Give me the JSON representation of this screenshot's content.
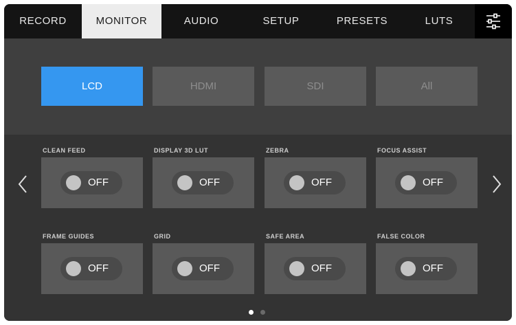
{
  "tabs": [
    {
      "label": "RECORD",
      "active": false
    },
    {
      "label": "MONITOR",
      "active": true
    },
    {
      "label": "AUDIO",
      "active": false
    },
    {
      "label": "SETUP",
      "active": false
    },
    {
      "label": "PRESETS",
      "active": false
    },
    {
      "label": "LUTS",
      "active": false
    }
  ],
  "settings_icon": "sliders-icon",
  "outputs": [
    {
      "label": "LCD",
      "active": true
    },
    {
      "label": "HDMI",
      "active": false
    },
    {
      "label": "SDI",
      "active": false
    },
    {
      "label": "All",
      "active": false
    }
  ],
  "toggles": [
    {
      "label": "CLEAN FEED",
      "state": "OFF"
    },
    {
      "label": "DISPLAY 3D LUT",
      "state": "OFF"
    },
    {
      "label": "ZEBRA",
      "state": "OFF"
    },
    {
      "label": "FOCUS ASSIST",
      "state": "OFF"
    },
    {
      "label": "FRAME GUIDES",
      "state": "OFF"
    },
    {
      "label": "GRID",
      "state": "OFF"
    },
    {
      "label": "SAFE AREA",
      "state": "OFF"
    },
    {
      "label": "FALSE COLOR",
      "state": "OFF"
    }
  ],
  "pagination": {
    "current": 1,
    "total": 2
  },
  "colors": {
    "accent": "#3597f0",
    "tab_bar": "#141414",
    "active_tab": "#ececec"
  }
}
